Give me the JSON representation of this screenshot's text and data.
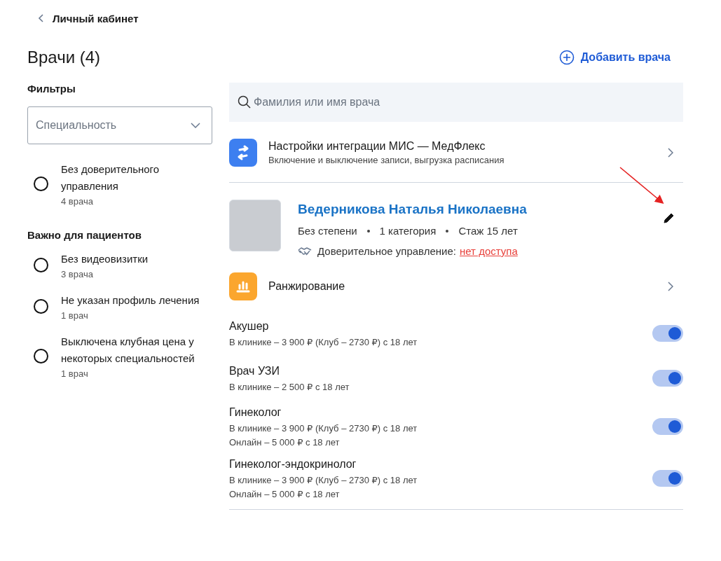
{
  "back_link": {
    "label": "Личный кабинет"
  },
  "title": "Врачи (4)",
  "add_button": {
    "label": "Добавить врача"
  },
  "filters": {
    "title": "Фильтры",
    "select": {
      "placeholder": "Специальность"
    },
    "groups": [
      {
        "items": [
          {
            "label": "Без доверительного управления",
            "count": "4 врача",
            "selected": false
          }
        ]
      },
      {
        "title": "Важно для пациентов",
        "items": [
          {
            "label": "Без видеовизитки",
            "count": "3 врача",
            "selected": false
          },
          {
            "label": "Не указан профиль лечения",
            "count": "1 врач",
            "selected": false
          },
          {
            "label": "Выключена клубная цена у некоторых специальностей",
            "count": "1 врач",
            "selected": false
          }
        ]
      }
    ]
  },
  "search": {
    "placeholder": "Фамилия или имя врача"
  },
  "integration": {
    "title": "Настройки интеграции МИС — МедФлекс",
    "subtitle": "Включение и выключение записи, выгрузка расписания"
  },
  "doctor": {
    "name": "Ведерникова Наталья Николаевна",
    "facts": [
      "Без степени",
      "1 категория",
      "Стаж 15 лет"
    ],
    "trust_label": "Доверительное управление:",
    "trust_link": "нет доступа",
    "ranking": {
      "label": "Ранжирование"
    },
    "specialties": [
      {
        "name": "Акушер",
        "prices": [
          "В клинике – 3 900 ₽ (Клуб – 2730 ₽) с 18 лет"
        ],
        "on": true
      },
      {
        "name": "Врач УЗИ",
        "prices": [
          "В клинике – 2 500 ₽ с 18 лет"
        ],
        "on": true
      },
      {
        "name": "Гинеколог",
        "prices": [
          "В клинике – 3 900 ₽ (Клуб – 2730 ₽) с 18 лет",
          "Онлайн – 5 000 ₽ с 18 лет"
        ],
        "on": true
      },
      {
        "name": "Гинеколог-эндокринолог",
        "prices": [
          "В клинике – 3 900 ₽ (Клуб – 2730 ₽) с 18 лет",
          "Онлайн – 5 000 ₽ с 18 лет"
        ],
        "on": true
      }
    ]
  }
}
